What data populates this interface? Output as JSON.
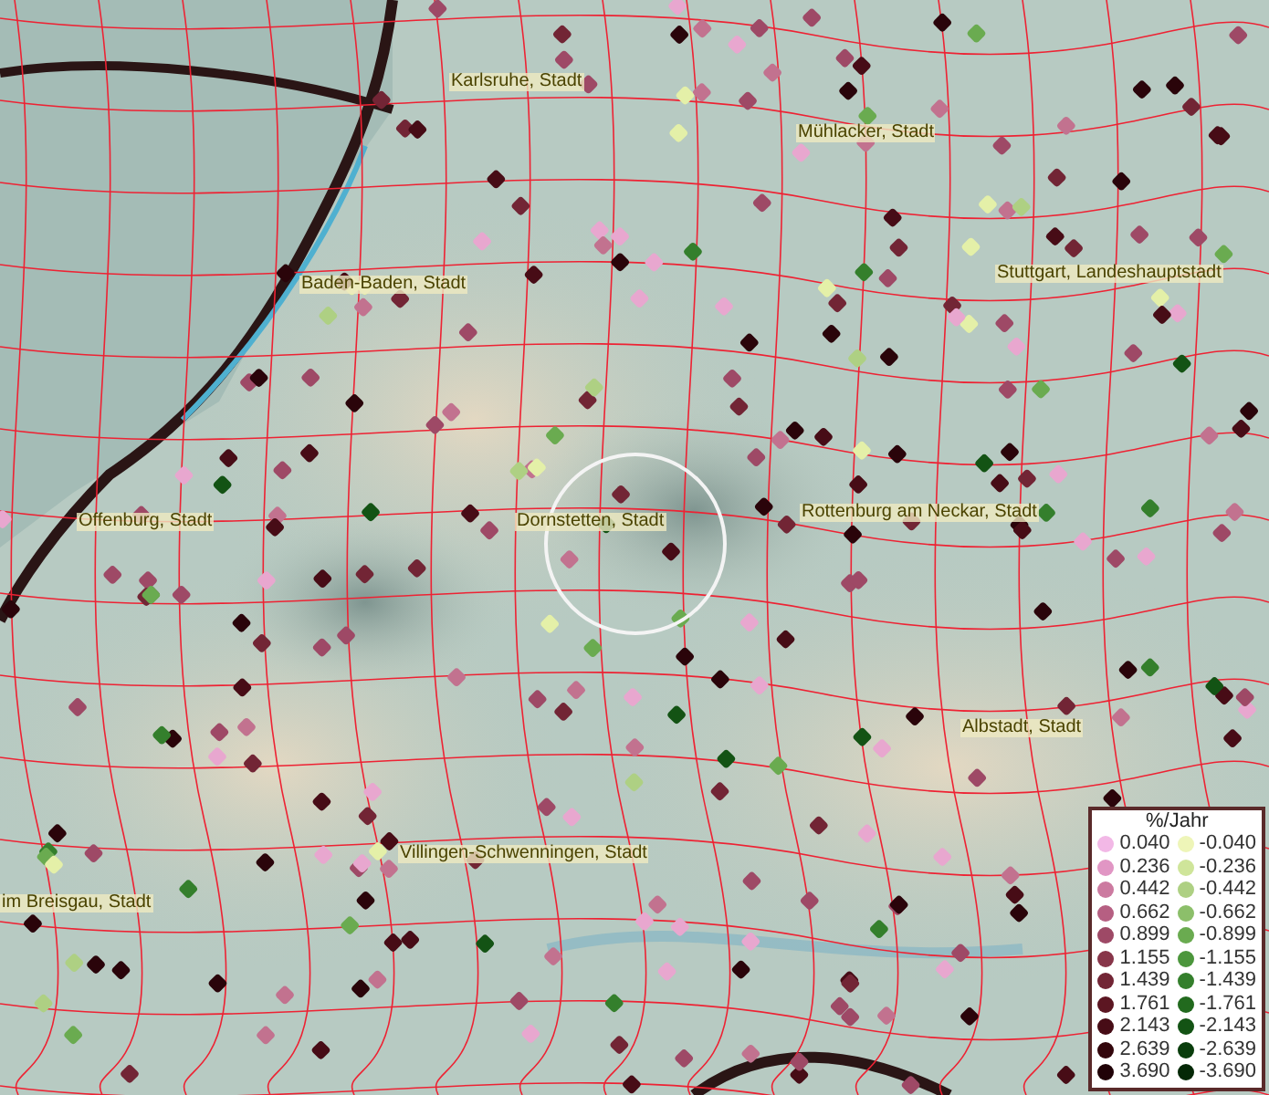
{
  "map": {
    "places": [
      "Karlsruhe, Stadt",
      "Mühlacker, Stadt",
      "Baden-Baden, Stadt",
      "Stuttgart, Landeshauptstadt",
      "Offenburg, Stadt",
      "Dornstetten, Stadt",
      "Rottenburg am Neckar, Stadt",
      "Albstadt, Stadt",
      "Villingen-Schwenningen, Stadt",
      "im Breisgau, Stadt"
    ]
  },
  "legend": {
    "title": "%/Jahr",
    "positive": [
      {
        "label": "0.040",
        "color": "#f2b8e6"
      },
      {
        "label": "0.236",
        "color": "#e196c4"
      },
      {
        "label": "0.442",
        "color": "#cc7aa0"
      },
      {
        "label": "0.662",
        "color": "#b65f82"
      },
      {
        "label": "0.899",
        "color": "#9e4966"
      },
      {
        "label": "1.155",
        "color": "#873549"
      },
      {
        "label": "1.439",
        "color": "#722535"
      },
      {
        "label": "1.761",
        "color": "#5c1622"
      },
      {
        "label": "2.143",
        "color": "#470c16"
      },
      {
        "label": "2.639",
        "color": "#33060c"
      },
      {
        "label": "3.690",
        "color": "#200207"
      }
    ],
    "negative": [
      {
        "label": "-0.040",
        "color": "#eef5b8"
      },
      {
        "label": "-0.236",
        "color": "#cfe59a"
      },
      {
        "label": "-0.442",
        "color": "#aed083"
      },
      {
        "label": "-0.662",
        "color": "#8cbf6a"
      },
      {
        "label": "-0.899",
        "color": "#6aab50"
      },
      {
        "label": "-1.155",
        "color": "#4c963c"
      },
      {
        "label": "-1.439",
        "color": "#347f2c"
      },
      {
        "label": "-1.761",
        "color": "#226a1e"
      },
      {
        "label": "-2.143",
        "color": "#135314"
      },
      {
        "label": "-2.639",
        "color": "#093d0c"
      },
      {
        "label": "-3.690",
        "color": "#042806"
      }
    ]
  }
}
